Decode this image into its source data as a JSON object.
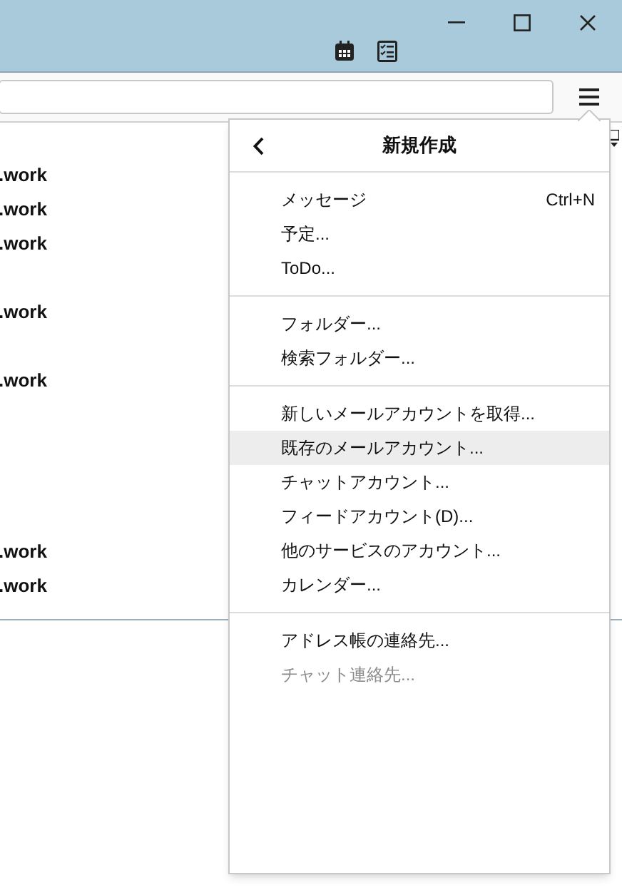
{
  "message_list": {
    "rows": [
      {
        "kind": "message",
        "sender": ".work"
      },
      {
        "kind": "message",
        "sender": ".work"
      },
      {
        "kind": "message",
        "sender": ".work"
      },
      {
        "kind": "blank"
      },
      {
        "kind": "message",
        "sender": ".work"
      },
      {
        "kind": "blank"
      },
      {
        "kind": "message",
        "sender": ".work"
      },
      {
        "kind": "blank"
      },
      {
        "kind": "blank"
      },
      {
        "kind": "blank"
      },
      {
        "kind": "blank"
      },
      {
        "kind": "message",
        "sender": ".work"
      },
      {
        "kind": "message",
        "sender": ".work"
      }
    ]
  },
  "menu": {
    "title": "新規作成",
    "groups": [
      [
        {
          "label": "メッセージ",
          "shortcut": "Ctrl+N",
          "highlighted": false,
          "disabled": false
        },
        {
          "label": "予定...",
          "highlighted": false,
          "disabled": false
        },
        {
          "label": "ToDo...",
          "highlighted": false,
          "disabled": false
        }
      ],
      [
        {
          "label": "フォルダー...",
          "highlighted": false,
          "disabled": false
        },
        {
          "label": "検索フォルダー...",
          "highlighted": false,
          "disabled": false
        }
      ],
      [
        {
          "label": "新しいメールアカウントを取得...",
          "highlighted": false,
          "disabled": false
        },
        {
          "label": "既存のメールアカウント...",
          "highlighted": true,
          "disabled": false
        },
        {
          "label": "チャットアカウント...",
          "highlighted": false,
          "disabled": false
        },
        {
          "label": "フィードアカウント(D)...",
          "highlighted": false,
          "disabled": false
        },
        {
          "label": "他のサービスのアカウント...",
          "highlighted": false,
          "disabled": false
        },
        {
          "label": "カレンダー...",
          "highlighted": false,
          "disabled": false
        }
      ],
      [
        {
          "label": "アドレス帳の連絡先...",
          "highlighted": false,
          "disabled": false
        },
        {
          "label": "チャット連絡先...",
          "highlighted": false,
          "disabled": true
        }
      ]
    ]
  }
}
